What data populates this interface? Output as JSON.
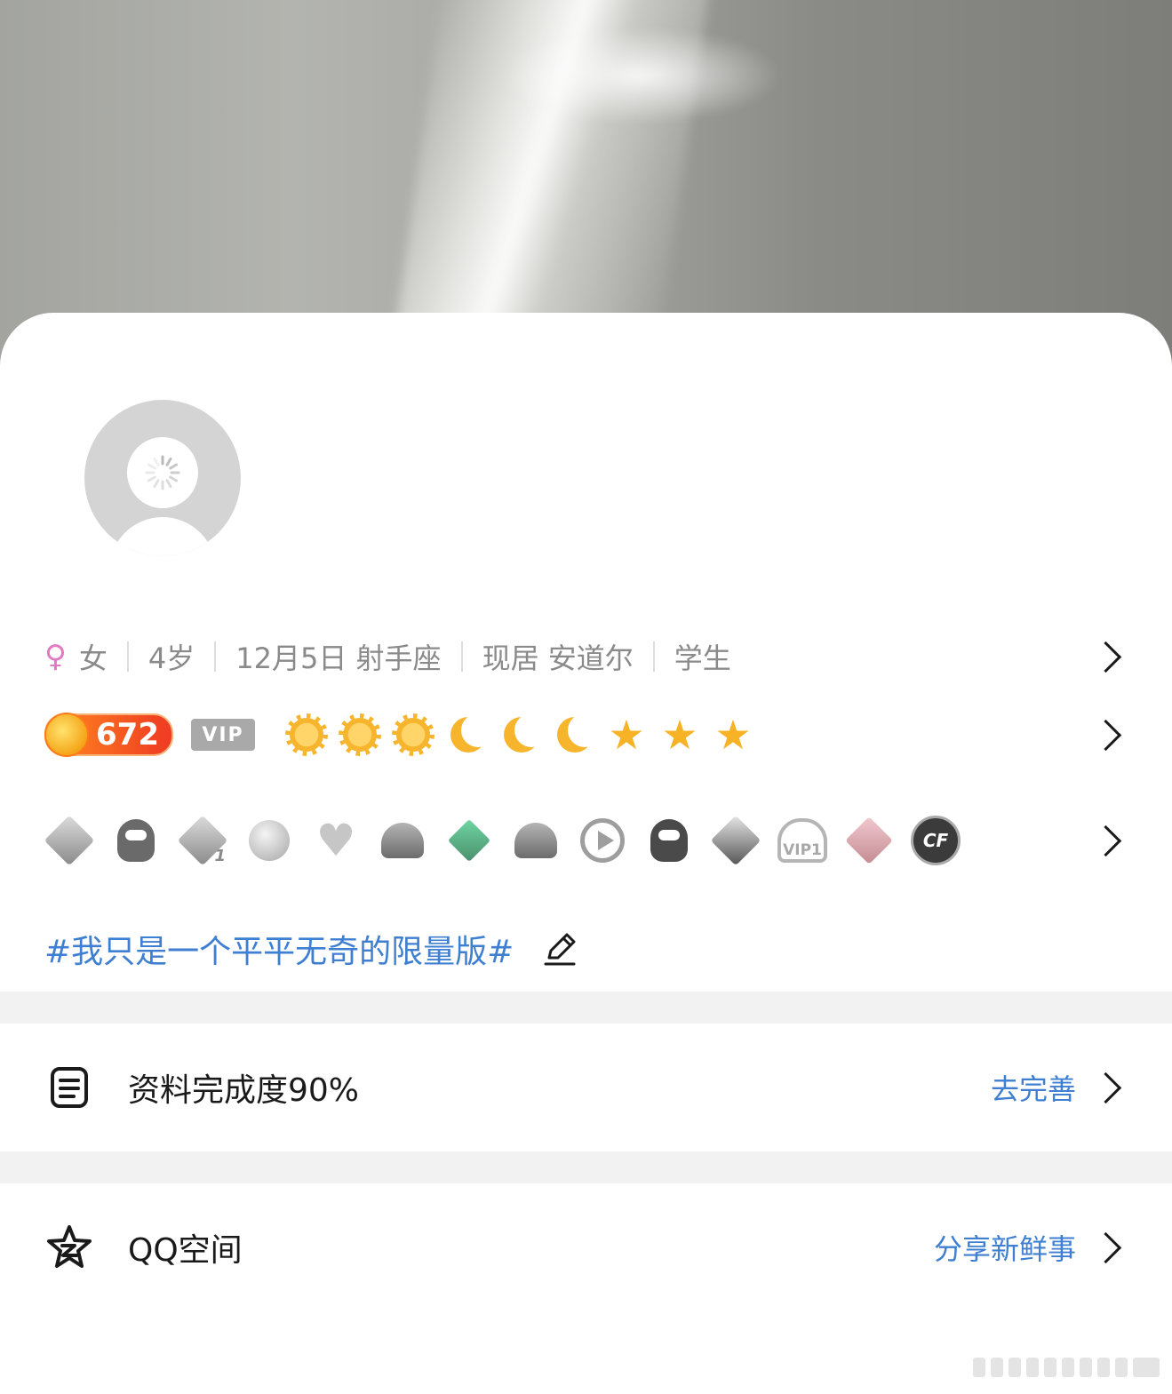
{
  "profile": {
    "gender_icon": "female-icon",
    "gender": "女",
    "age": "4岁",
    "birthday": "12月5日 射手座",
    "location": "现居 安道尔",
    "occupation": "学生"
  },
  "level": {
    "value": "672",
    "vip_label": "VIP",
    "icons": [
      "sun",
      "sun",
      "sun",
      "moon",
      "moon",
      "moon",
      "star",
      "star",
      "star"
    ]
  },
  "badges": [
    "penguin-wing",
    "penguin-hat",
    "diamond-1",
    "bomb-face",
    "heart",
    "penguin-lightning",
    "green-diamond",
    "penguin-fold",
    "play",
    "penguin-crown",
    "silver-diamond",
    "cloud-vip1",
    "pink-diamond",
    "cf-logo"
  ],
  "badge_texts": {
    "cloud": "VIP1",
    "cf": "CF",
    "diamond_num": "1"
  },
  "signature": "#我只是一个平平无奇的限量版#",
  "profile_completion": {
    "label": "资料完成度90%",
    "action": "去完善",
    "value_percent": 90
  },
  "qzone": {
    "label": "QQ空间",
    "action": "分享新鲜事"
  },
  "colors": {
    "accent_blue": "#3f7fd1",
    "gender_pink": "#e27ac3",
    "level_orange": "#ef3a23"
  }
}
